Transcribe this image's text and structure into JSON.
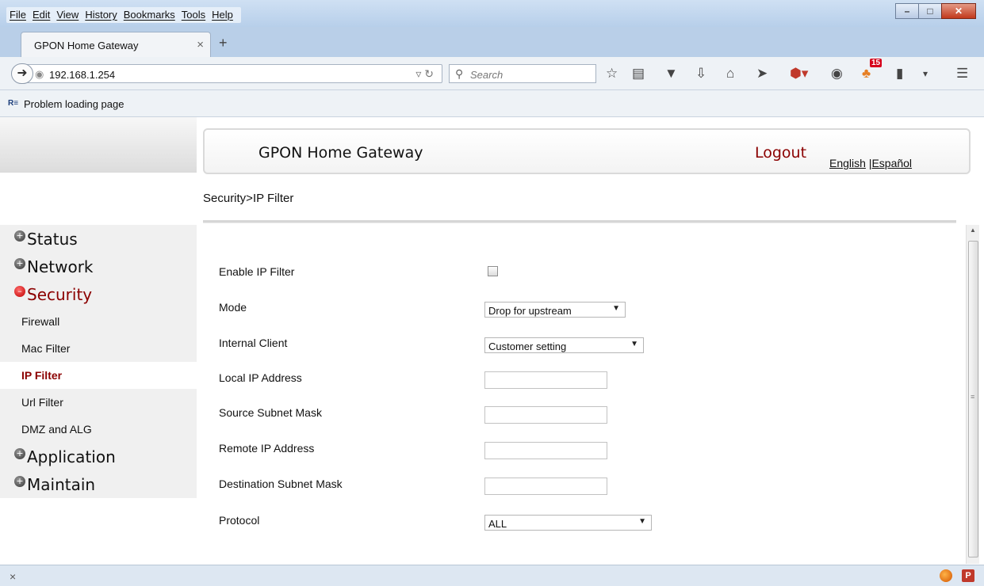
{
  "browser": {
    "menu": [
      "File",
      "Edit",
      "View",
      "History",
      "Bookmarks",
      "Tools",
      "Help"
    ],
    "tab_title": "GPON Home Gateway",
    "tab_close": "×",
    "new_tab": "+",
    "url": "192.168.1.254",
    "search_placeholder": "Search",
    "bookmark_label": "Problem loading page",
    "bookmark_icon_text": "R≡",
    "addon_badge": "15",
    "status_close": "×"
  },
  "header": {
    "title": "GPON Home Gateway",
    "logout": "Logout",
    "lang_english": "English",
    "lang_sep": " |",
    "lang_spanish": "Español"
  },
  "breadcrumb": "Security>IP Filter",
  "sidebar": {
    "status": "Status",
    "network": "Network",
    "security": "Security",
    "firewall": "Firewall",
    "mac_filter": "Mac Filter",
    "ip_filter": "IP Filter",
    "url_filter": "Url Filter",
    "dmz_alg": "DMZ and ALG",
    "application": "Application",
    "maintain": "Maintain"
  },
  "form": {
    "enable_label": "Enable IP Filter",
    "enable_checked": false,
    "mode_label": "Mode",
    "mode_value": "Drop for upstream",
    "internal_client_label": "Internal Client",
    "internal_client_value": "Customer setting",
    "local_ip_label": "Local IP Address",
    "source_mask_label": "Source Subnet Mask",
    "remote_ip_label": "Remote IP Address",
    "dest_mask_label": "Destination Subnet Mask",
    "protocol_label": "Protocol",
    "protocol_value": "ALL"
  },
  "colors": {
    "accent": "#8b0000",
    "sidebar_bg": "#f0f0f0",
    "chrome_blue": "#b9cfe8"
  }
}
